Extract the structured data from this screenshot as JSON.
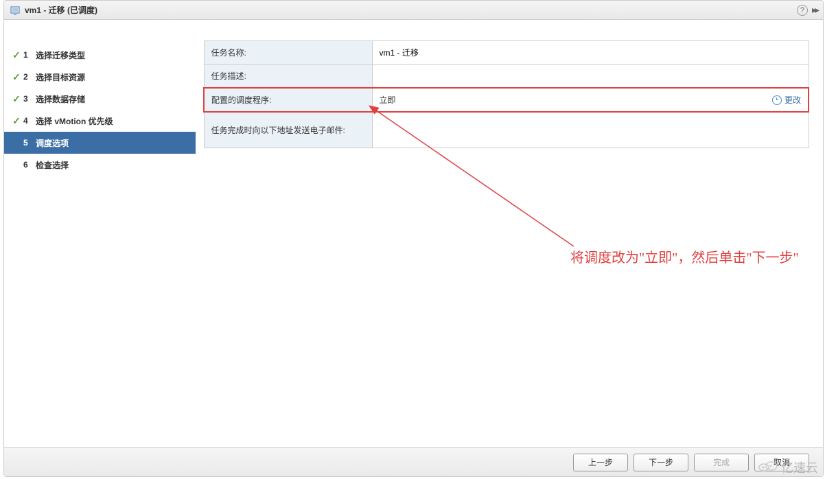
{
  "dialog": {
    "title": "vm1 - 迁移 (已调度)"
  },
  "steps": [
    {
      "num": "1",
      "label": "选择迁移类型",
      "state": "done"
    },
    {
      "num": "2",
      "label": "选择目标资源",
      "state": "done"
    },
    {
      "num": "3",
      "label": "选择数据存储",
      "state": "done"
    },
    {
      "num": "4",
      "label": "选择 vMotion 优先级",
      "state": "done"
    },
    {
      "num": "5",
      "label": "调度选项",
      "state": "active"
    },
    {
      "num": "6",
      "label": "检查选择",
      "state": "pending"
    }
  ],
  "form": {
    "task_name_label": "任务名称:",
    "task_name_value": "vm1 - 迁移",
    "task_desc_label": "任务描述:",
    "task_desc_value": "",
    "scheduler_label": "配置的调度程序:",
    "scheduler_value": "立即",
    "change_text": "更改",
    "email_label": "任务完成时向以下地址发送电子邮件:",
    "email_value": ""
  },
  "annotation": {
    "text": "将调度改为\"立即\"，然后单击\"下一步\""
  },
  "footer": {
    "back": "上一步",
    "next": "下一步",
    "finish": "完成",
    "cancel": "取消"
  },
  "watermark": {
    "text": "亿速云"
  }
}
